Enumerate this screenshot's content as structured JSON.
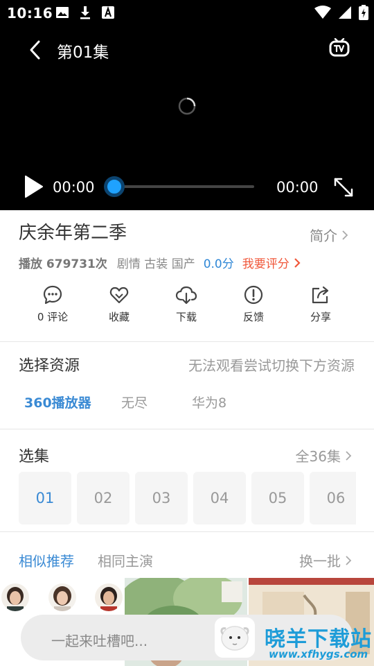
{
  "status_bar": {
    "time": "10:16",
    "icons": [
      "image-icon",
      "download-icon",
      "font-icon",
      "wifi-icon",
      "signal-icon",
      "battery-icon"
    ]
  },
  "player": {
    "episode_title": "第01集",
    "current_time": "00:00",
    "total_time": "00:00",
    "progress": 0,
    "accent_color": "#1fa2ff"
  },
  "show": {
    "title": "庆余年第二季",
    "intro_label": "简介",
    "play_count": "播放 679731次",
    "genre": "剧情 古装 国产",
    "score": "0.0分",
    "rate_label": "我要评分"
  },
  "actions": [
    {
      "label": "0 评论",
      "icon": "comment-icon"
    },
    {
      "label": "收藏",
      "icon": "heart-icon"
    },
    {
      "label": "下载",
      "icon": "cloud-download-icon"
    },
    {
      "label": "反馈",
      "icon": "alert-icon"
    },
    {
      "label": "分享",
      "icon": "share-icon"
    }
  ],
  "resources": {
    "title": "选择资源",
    "hint": "无法观看尝试切换下方资源",
    "sources": [
      {
        "label": "360播放器",
        "active": true
      },
      {
        "label": "无尽",
        "active": false
      },
      {
        "label": "华为8",
        "active": false
      }
    ]
  },
  "episodes": {
    "title": "选集",
    "total_label": "全36集",
    "items": [
      "01",
      "02",
      "03",
      "04",
      "05",
      "06"
    ]
  },
  "recommend": {
    "tabs": [
      {
        "label": "相似推荐",
        "active": true
      },
      {
        "label": "相同主演",
        "active": false
      }
    ],
    "refresh_label": "换一批"
  },
  "comment_bar": {
    "placeholder": "一起来吐槽吧..."
  },
  "watermark": {
    "title": "晓羊下载站",
    "url": "www.xfhygs.com"
  },
  "colors": {
    "accent_blue": "#3a8ad4",
    "accent_orange": "#f0573a"
  }
}
